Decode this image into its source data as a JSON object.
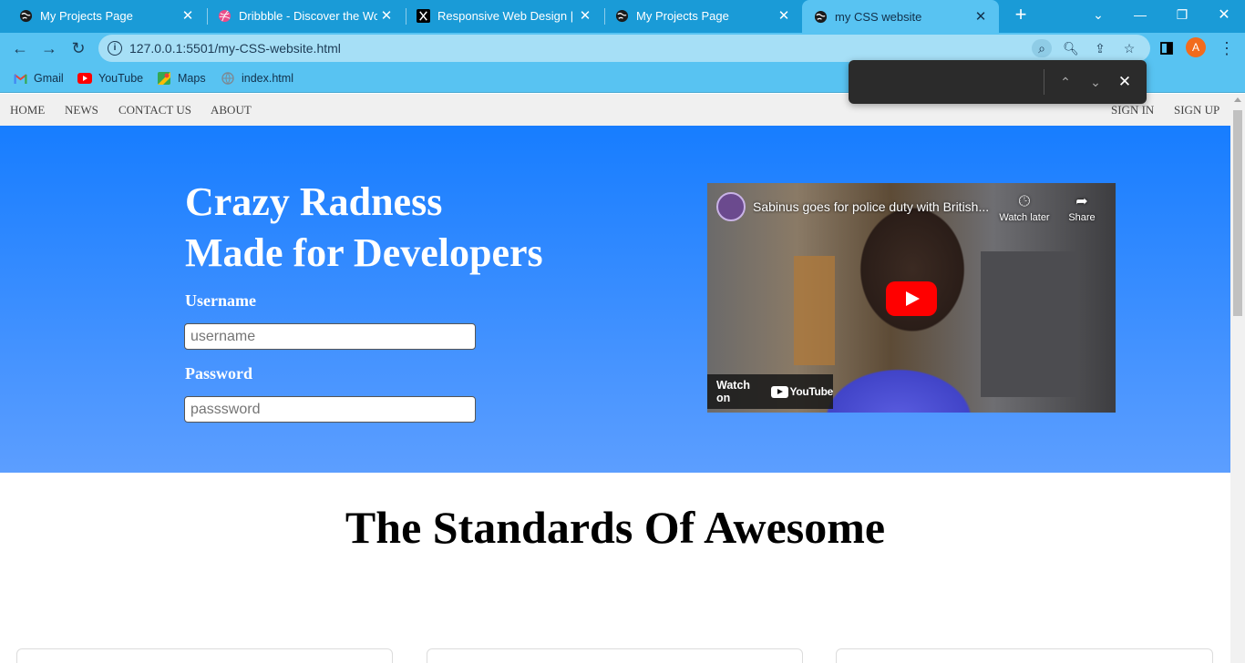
{
  "browser": {
    "tabs": [
      {
        "title": "My Projects Page",
        "favicon": "globe-icon"
      },
      {
        "title": "Dribbble - Discover the World",
        "favicon": "dribbble-icon"
      },
      {
        "title": "Responsive Web Design | We",
        "favicon": "x-icon"
      },
      {
        "title": "My Projects Page",
        "favicon": "globe-icon"
      },
      {
        "title": "my CSS website",
        "favicon": "globe-icon",
        "active": true
      }
    ],
    "url": "127.0.0.1:5501/my-CSS-website.html",
    "profile_initial": "A",
    "bookmarks": [
      {
        "label": "Gmail",
        "icon": "gmail-icon"
      },
      {
        "label": "YouTube",
        "icon": "youtube-icon"
      },
      {
        "label": "Maps",
        "icon": "maps-icon"
      },
      {
        "label": "index.html",
        "icon": "globe-icon"
      }
    ],
    "colors": {
      "tabstrip": "#1a9bd7",
      "toolbar": "#58c3f2",
      "omnibox": "#a6dff6"
    }
  },
  "site": {
    "nav_left": [
      "HOME",
      "NEWS",
      "CONTACT US",
      "ABOUT"
    ],
    "nav_right": [
      "SIGN IN",
      "SIGN UP"
    ],
    "hero": {
      "title_line1": "Crazy Radness",
      "title_line2": "Made for Developers",
      "username_label": "Username",
      "username_placeholder": "username",
      "password_label": "Password",
      "password_placeholder": "passsword",
      "gradient": [
        "#177dff",
        "#5c9eff"
      ]
    },
    "video": {
      "title": "Sabinus goes for police duty with British...",
      "watch_later": "Watch later",
      "share": "Share",
      "watch_on": "Watch on",
      "youtube": "YouTube"
    },
    "section_title": "The Standards Of Awesome"
  }
}
